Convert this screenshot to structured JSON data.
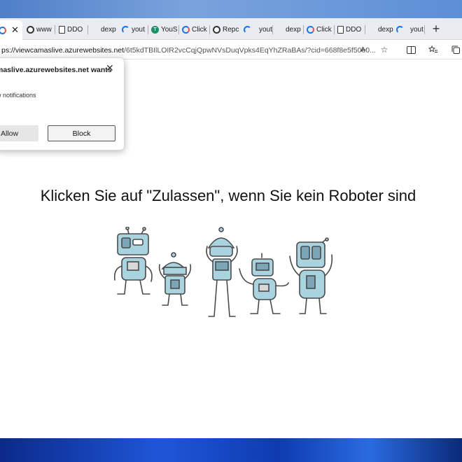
{
  "tabs": [
    {
      "label": "",
      "icon": "globe-icon"
    },
    {
      "label": "www",
      "icon": "dark-site-icon"
    },
    {
      "label": "DDO",
      "icon": "document-icon"
    },
    {
      "label": "dexp",
      "icon": "blank-icon"
    },
    {
      "label": "yout",
      "icon": "loading-icon"
    },
    {
      "label": "YouS",
      "icon": "green-t-icon"
    },
    {
      "label": "Click",
      "icon": "refresh-site-icon"
    },
    {
      "label": "Repc",
      "icon": "dark-site-icon"
    },
    {
      "label": "yout",
      "icon": "loading-icon"
    },
    {
      "label": "dexp",
      "icon": "blank-icon"
    },
    {
      "label": "Click",
      "icon": "refresh-site-icon"
    },
    {
      "label": "DDO",
      "icon": "document-icon"
    },
    {
      "label": "dexp",
      "icon": "blank-icon"
    },
    {
      "label": "yout",
      "icon": "loading-icon"
    }
  ],
  "address": {
    "host": "ps://viewcamaslive.azurewebsites.net",
    "path": "/6t5kdTBIlLOIR2vcCqjQpwNVsDuqVpks4EqYhZRaBAs/?cid=668f8e5f50e0..."
  },
  "prompt": {
    "title": "maslive.azurewebsites.net wants",
    "body": "w notifications",
    "allow": "Allow",
    "block": "Block"
  },
  "headline": "Klicken Sie auf \"Zulassen\", wenn Sie kein Roboter sind",
  "colors": {
    "robot_fill": "#a9d4df",
    "robot_stroke": "#4a4a4a",
    "robot_screen": "#7ba6b8"
  }
}
